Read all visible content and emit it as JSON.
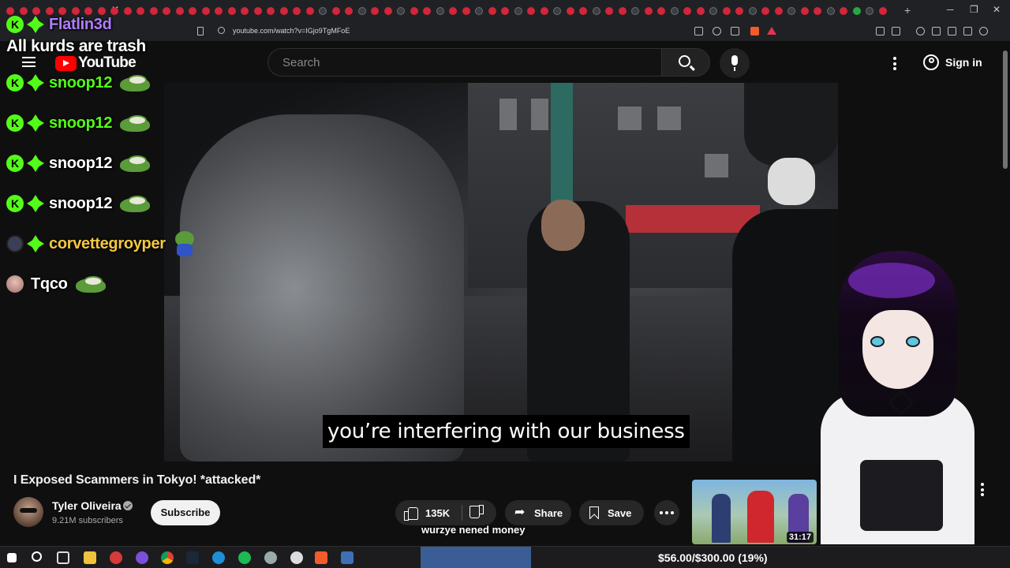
{
  "browser": {
    "url": "youtube.com/watch?v=IGjo9TgMFoE",
    "colors": {
      "tab_strip": "#202124",
      "tab_indicator": "#d1263b"
    }
  },
  "youtube": {
    "logo_text": "YouTube",
    "search_placeholder": "Search",
    "signin_label": "Sign in",
    "icons": [
      "menu-icon",
      "search-icon",
      "microphone-icon",
      "more-vert-icon",
      "account-icon"
    ]
  },
  "video": {
    "caption": "you’re interfering with our business",
    "title": "I Exposed Scammers in Tokyo! *attacked*",
    "channel_name": "Tyler Oliveira",
    "subscribers": "9.21M subscribers",
    "subscribe_label": "Subscribe",
    "likes": "135K",
    "share_label": "Share",
    "save_label": "Save"
  },
  "recommended": {
    "duration": "31:17"
  },
  "stream_overlay": {
    "top_user": "Flatlin3d",
    "top_message": "All kurds are trash",
    "chat": [
      {
        "user": "snoop12"
      },
      {
        "user": "snoop12"
      },
      {
        "user": "snoop12"
      },
      {
        "user": "snoop12"
      },
      {
        "user": "corvettegroyper"
      },
      {
        "user": "Tqco"
      }
    ],
    "lower_message": "wurzye nened money",
    "donation_goal": "$56.00/$300.00 (19%)",
    "donation_progress": 0.19,
    "colors": {
      "kick_green": "#53fc18",
      "user_purple": "#b17dff",
      "user_gold": "#f5c842"
    }
  }
}
